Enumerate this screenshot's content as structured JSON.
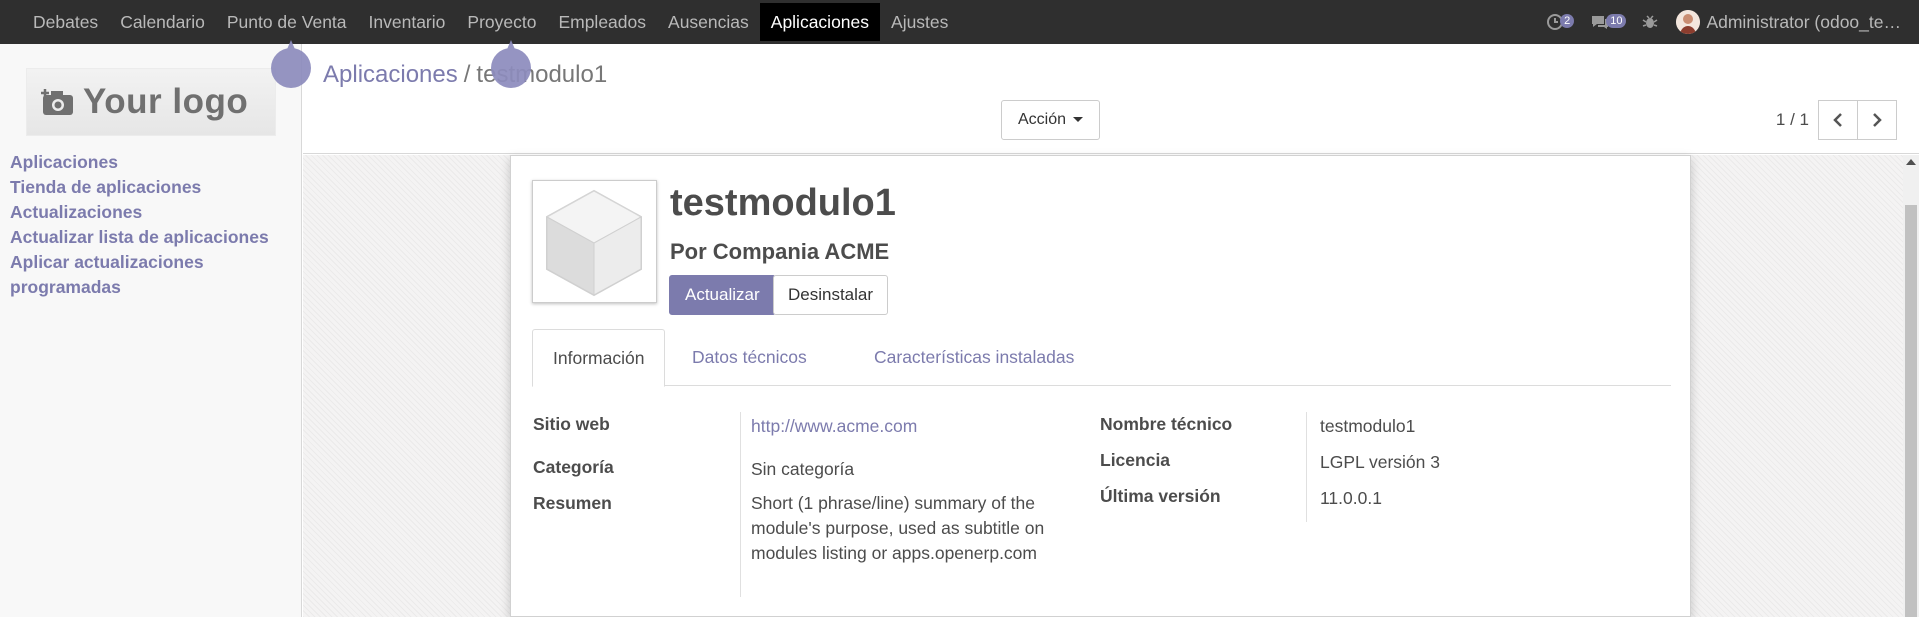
{
  "topbar": {
    "menu": [
      "Debates",
      "Calendario",
      "Punto de Venta",
      "Inventario",
      "Proyecto",
      "Empleados",
      "Ausencias",
      "Aplicaciones",
      "Ajustes"
    ],
    "active_index": 7,
    "activity_count": "2",
    "message_count": "10",
    "user_label": "Administrator (odoo_te…"
  },
  "sidebar": {
    "logo_text": "Your logo",
    "items": [
      "Aplicaciones",
      "Tienda de aplicaciones",
      "Actualizaciones",
      "Actualizar lista de aplicaciones",
      "Aplicar actualizaciones programadas"
    ]
  },
  "control": {
    "breadcrumb_parent": "Aplicaciones",
    "breadcrumb_sep": "/",
    "breadcrumb_current": "testmodulo1",
    "action_label": "Acción",
    "pager": "1 / 1"
  },
  "module": {
    "name": "testmodulo1",
    "author": "Por Compania ACME",
    "btn_update": "Actualizar",
    "btn_uninstall": "Desinstalar"
  },
  "tabs": [
    "Información",
    "Datos técnicos",
    "Características instaladas"
  ],
  "info": {
    "website_label": "Sitio web",
    "website_value": "http://www.acme.com",
    "category_label": "Categoría",
    "category_value": "Sin categoría",
    "summary_label": "Resumen",
    "summary_value": "Short (1 phrase/line) summary of the module's purpose, used as subtitle on modules listing or apps.openerp.com",
    "tech_name_label": "Nombre técnico",
    "tech_name_value": "testmodulo1",
    "license_label": "Licencia",
    "license_value": "LGPL versión 3",
    "latest_version_label": "Última versión",
    "latest_version_value": "11.0.0.1"
  },
  "colors": {
    "brand": "#7c7bad",
    "navbar": "#2f2f2f"
  }
}
